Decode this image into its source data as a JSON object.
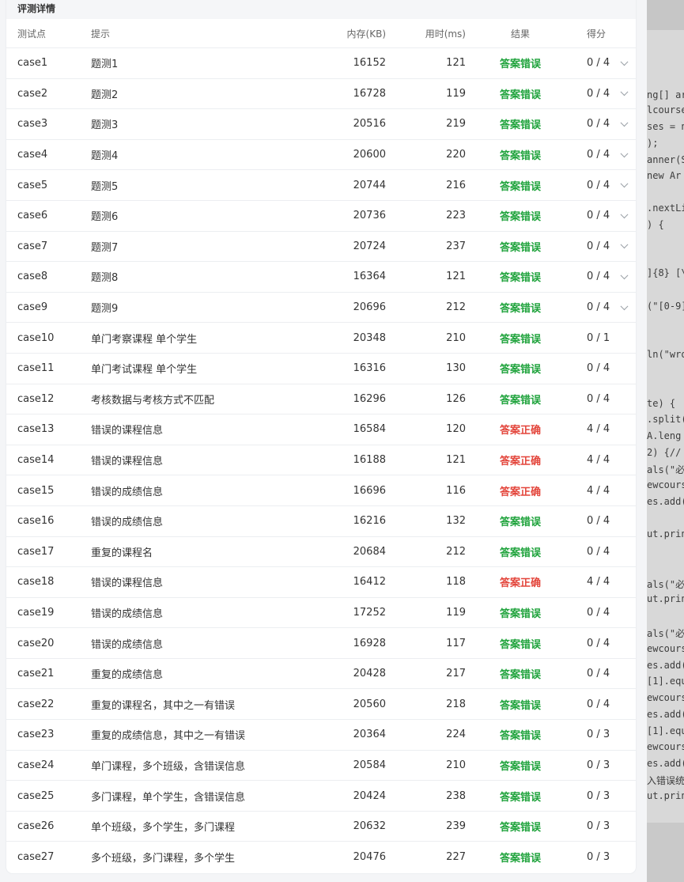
{
  "panel": {
    "title": "评测详情"
  },
  "columns": {
    "case": "测试点",
    "hint": "提示",
    "memory": "内存(KB)",
    "time": "用时(ms)",
    "result": "结果",
    "score": "得分"
  },
  "rows": [
    {
      "case": "case1",
      "hint": "题测1",
      "memory": "16152",
      "time": "121",
      "result": "答案错误",
      "score": "0 / 4",
      "expandable": true
    },
    {
      "case": "case2",
      "hint": "题测2",
      "memory": "16728",
      "time": "119",
      "result": "答案错误",
      "score": "0 / 4",
      "expandable": true
    },
    {
      "case": "case3",
      "hint": "题测3",
      "memory": "20516",
      "time": "219",
      "result": "答案错误",
      "score": "0 / 4",
      "expandable": true
    },
    {
      "case": "case4",
      "hint": "题测4",
      "memory": "20600",
      "time": "220",
      "result": "答案错误",
      "score": "0 / 4",
      "expandable": true
    },
    {
      "case": "case5",
      "hint": "题测5",
      "memory": "20744",
      "time": "216",
      "result": "答案错误",
      "score": "0 / 4",
      "expandable": true
    },
    {
      "case": "case6",
      "hint": "题测6",
      "memory": "20736",
      "time": "223",
      "result": "答案错误",
      "score": "0 / 4",
      "expandable": true
    },
    {
      "case": "case7",
      "hint": "题测7",
      "memory": "20724",
      "time": "237",
      "result": "答案错误",
      "score": "0 / 4",
      "expandable": true
    },
    {
      "case": "case8",
      "hint": "题测8",
      "memory": "16364",
      "time": "121",
      "result": "答案错误",
      "score": "0 / 4",
      "expandable": true
    },
    {
      "case": "case9",
      "hint": "题测9",
      "memory": "20696",
      "time": "212",
      "result": "答案错误",
      "score": "0 / 4",
      "expandable": true
    },
    {
      "case": "case10",
      "hint": "单门考察课程 单个学生",
      "memory": "20348",
      "time": "210",
      "result": "答案错误",
      "score": "0 / 1",
      "expandable": false
    },
    {
      "case": "case11",
      "hint": "单门考试课程 单个学生",
      "memory": "16316",
      "time": "130",
      "result": "答案错误",
      "score": "0 / 4",
      "expandable": false
    },
    {
      "case": "case12",
      "hint": "考核数据与考核方式不匹配",
      "memory": "16296",
      "time": "126",
      "result": "答案错误",
      "score": "0 / 4",
      "expandable": false
    },
    {
      "case": "case13",
      "hint": "错误的课程信息",
      "memory": "16584",
      "time": "120",
      "result": "答案正确",
      "score": "4 / 4",
      "expandable": false
    },
    {
      "case": "case14",
      "hint": "错误的课程信息",
      "memory": "16188",
      "time": "121",
      "result": "答案正确",
      "score": "4 / 4",
      "expandable": false
    },
    {
      "case": "case15",
      "hint": "错误的成绩信息",
      "memory": "16696",
      "time": "116",
      "result": "答案正确",
      "score": "4 / 4",
      "expandable": false
    },
    {
      "case": "case16",
      "hint": "错误的成绩信息",
      "memory": "16216",
      "time": "132",
      "result": "答案错误",
      "score": "0 / 4",
      "expandable": false
    },
    {
      "case": "case17",
      "hint": "重复的课程名",
      "memory": "20684",
      "time": "212",
      "result": "答案错误",
      "score": "0 / 4",
      "expandable": false
    },
    {
      "case": "case18",
      "hint": "错误的课程信息",
      "memory": "16412",
      "time": "118",
      "result": "答案正确",
      "score": "4 / 4",
      "expandable": false
    },
    {
      "case": "case19",
      "hint": "错误的成绩信息",
      "memory": "17252",
      "time": "119",
      "result": "答案错误",
      "score": "0 / 4",
      "expandable": false
    },
    {
      "case": "case20",
      "hint": "错误的成绩信息",
      "memory": "16928",
      "time": "117",
      "result": "答案错误",
      "score": "0 / 4",
      "expandable": false
    },
    {
      "case": "case21",
      "hint": "重复的成绩信息",
      "memory": "20428",
      "time": "217",
      "result": "答案错误",
      "score": "0 / 4",
      "expandable": false
    },
    {
      "case": "case22",
      "hint": "重复的课程名，其中之一有错误",
      "memory": "20560",
      "time": "218",
      "result": "答案错误",
      "score": "0 / 4",
      "expandable": false
    },
    {
      "case": "case23",
      "hint": "重复的成绩信息，其中之一有错误",
      "memory": "20364",
      "time": "224",
      "result": "答案错误",
      "score": "0 / 3",
      "expandable": false
    },
    {
      "case": "case24",
      "hint": "单门课程，多个班级，含错误信息",
      "memory": "20584",
      "time": "210",
      "result": "答案错误",
      "score": "0 / 3",
      "expandable": false
    },
    {
      "case": "case25",
      "hint": "多门课程，单个学生，含错误信息",
      "memory": "20424",
      "time": "238",
      "result": "答案错误",
      "score": "0 / 3",
      "expandable": false
    },
    {
      "case": "case26",
      "hint": "单个班级，多个学生，多门课程",
      "memory": "20632",
      "time": "239",
      "result": "答案错误",
      "score": "0 / 3",
      "expandable": false
    },
    {
      "case": "case27",
      "hint": "多个班级，多门课程，多个学生",
      "memory": "20476",
      "time": "227",
      "result": "答案错误",
      "score": "0 / 3",
      "expandable": false
    }
  ],
  "code_fragments": [
    {
      "text": "ng[] ar"
    },
    {
      "text": "lcourse"
    },
    {
      "text": "ses = n"
    },
    {
      "text": ");"
    },
    {
      "text": "anner(S"
    },
    {
      "text": " new Ar"
    },
    {
      "text": ".nextLi"
    },
    {
      "text": ") {"
    },
    {
      "text": "]{8} [\\"
    },
    {
      "text": "(\"[0-9]"
    },
    {
      "text": "ln(\"wro"
    },
    {
      "text": "te) {"
    },
    {
      "text": ".split("
    },
    {
      "text": "A.leng"
    },
    {
      "text": "2) {//"
    },
    {
      "text": "als(\"必"
    },
    {
      "text": "ewcours"
    },
    {
      "text": "es.add("
    },
    {
      "text": "ut.prin"
    },
    {
      "text": "als(\"必"
    },
    {
      "text": "ut.prin"
    },
    {
      "text": "als(\"必"
    },
    {
      "text": "ewcours"
    },
    {
      "text": "es.add("
    },
    {
      "text": "[1].equ"
    },
    {
      "text": "ewcours"
    },
    {
      "text": "es.add("
    },
    {
      "text": "[1].equ"
    },
    {
      "text": "ewcours"
    },
    {
      "text": "es.add("
    },
    {
      "text": "入错误统"
    },
    {
      "text": "ut.prin"
    }
  ],
  "colors": {
    "wrong": "#1fa33c",
    "right": "#e3453b"
  }
}
